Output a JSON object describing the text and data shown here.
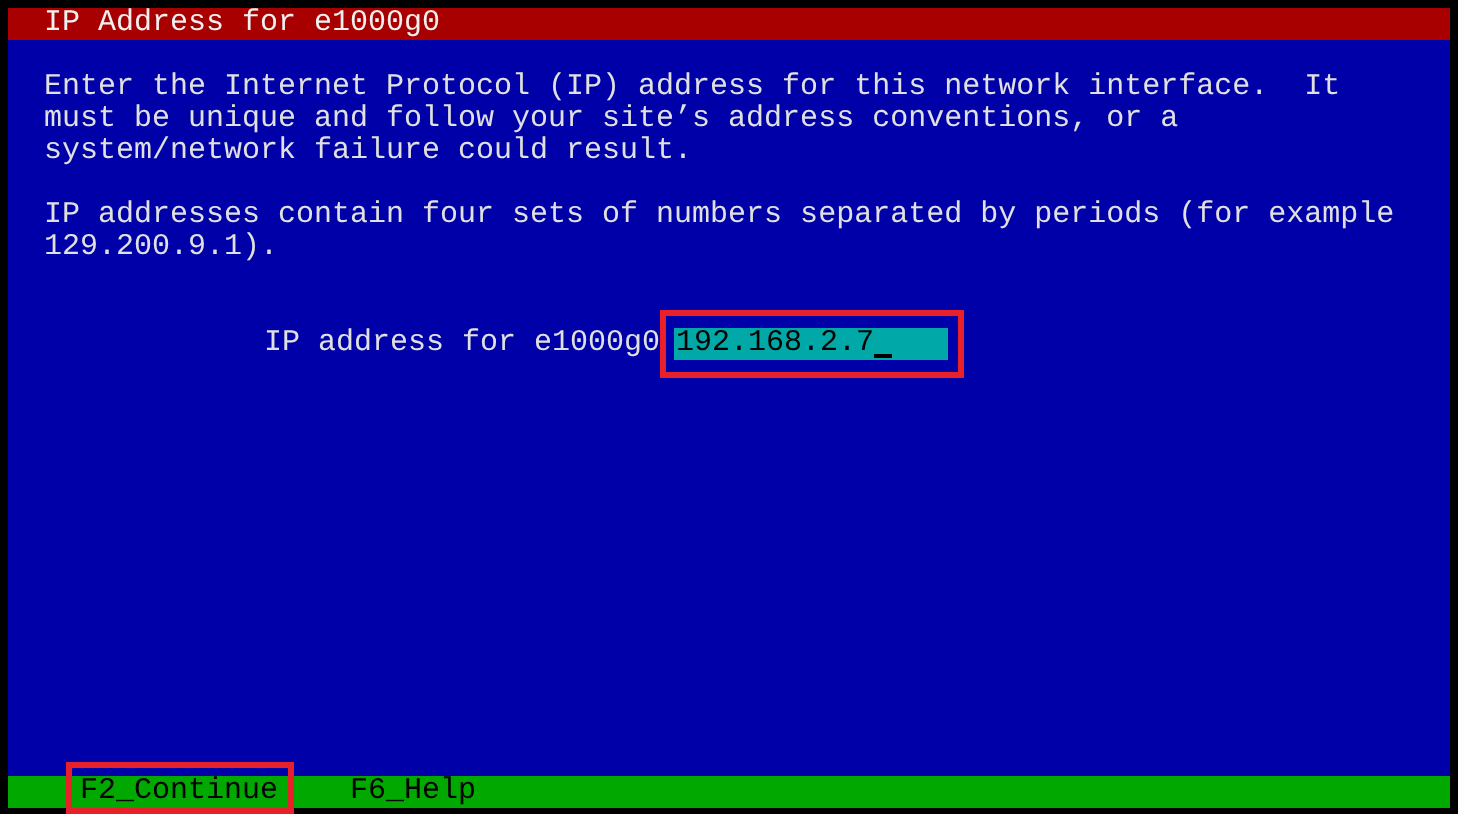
{
  "window": {
    "title": "IP Address for e1000g0"
  },
  "paragraphs": [
    "Enter the Internet Protocol (IP) address for this network interface.  It\nmust be unique and follow your site’s address conventions, or a\nsystem/network failure could result.",
    "IP addresses contain four sets of numbers separated by periods (for example\n129.200.9.1)."
  ],
  "field": {
    "label": "IP address for e1000g0",
    "value": "192.168.2.7"
  },
  "function_keys": [
    "F2_Continue",
    "F6_Help"
  ]
}
